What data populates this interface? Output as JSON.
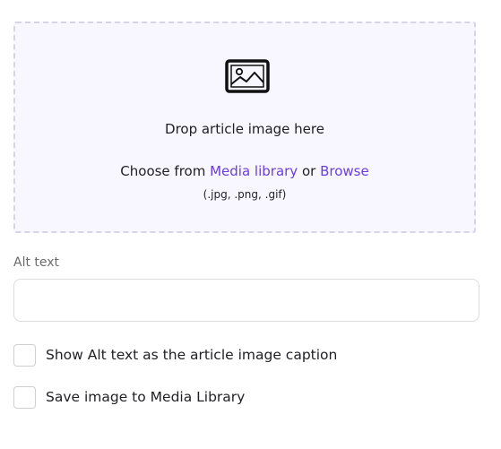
{
  "dropzone": {
    "icon": "image-icon",
    "title": "Drop article image here",
    "choose_prefix": "Choose from ",
    "media_library_link": "Media library",
    "or_text": " or ",
    "browse_link": "Browse",
    "formats": "(.jpg, .png, .gif)"
  },
  "alt_text": {
    "label": "Alt text",
    "value": "",
    "placeholder": ""
  },
  "options": [
    {
      "label": "Show Alt text as the article image caption",
      "checked": false
    },
    {
      "label": "Save image to Media Library",
      "checked": false
    }
  ],
  "colors": {
    "accent": "#6b3fd6",
    "dropzone_bg": "#f8f6fe",
    "dropzone_border": "#d8d4e6"
  }
}
